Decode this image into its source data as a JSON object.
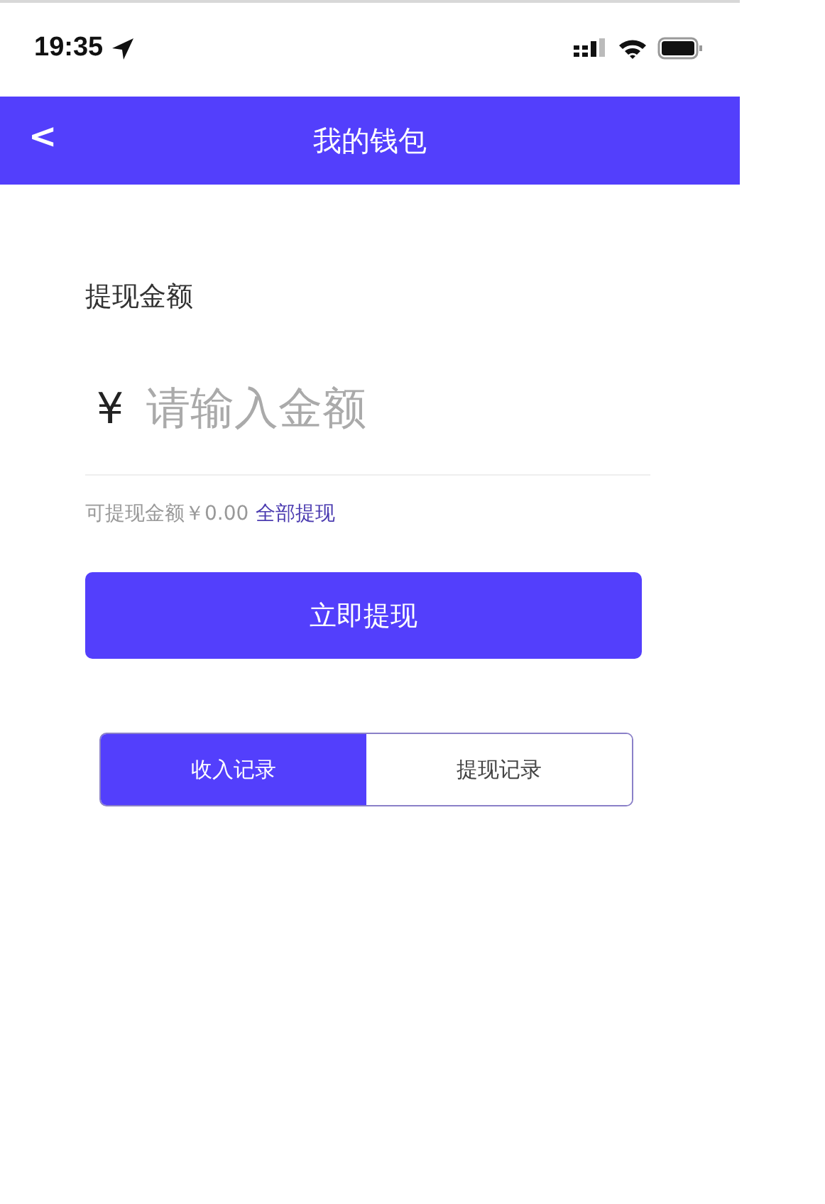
{
  "status_bar": {
    "time": "19:35"
  },
  "header": {
    "back": "<",
    "title": "我的钱包"
  },
  "withdraw": {
    "label": "提现金额",
    "currency": "¥",
    "placeholder": "请输入金额",
    "available": "可提现金额￥0.00",
    "withdraw_all": "全部提现",
    "submit": "立即提现"
  },
  "tabs": [
    {
      "label": "收入记录",
      "selected": true
    },
    {
      "label": "提现记录",
      "selected": false
    }
  ]
}
